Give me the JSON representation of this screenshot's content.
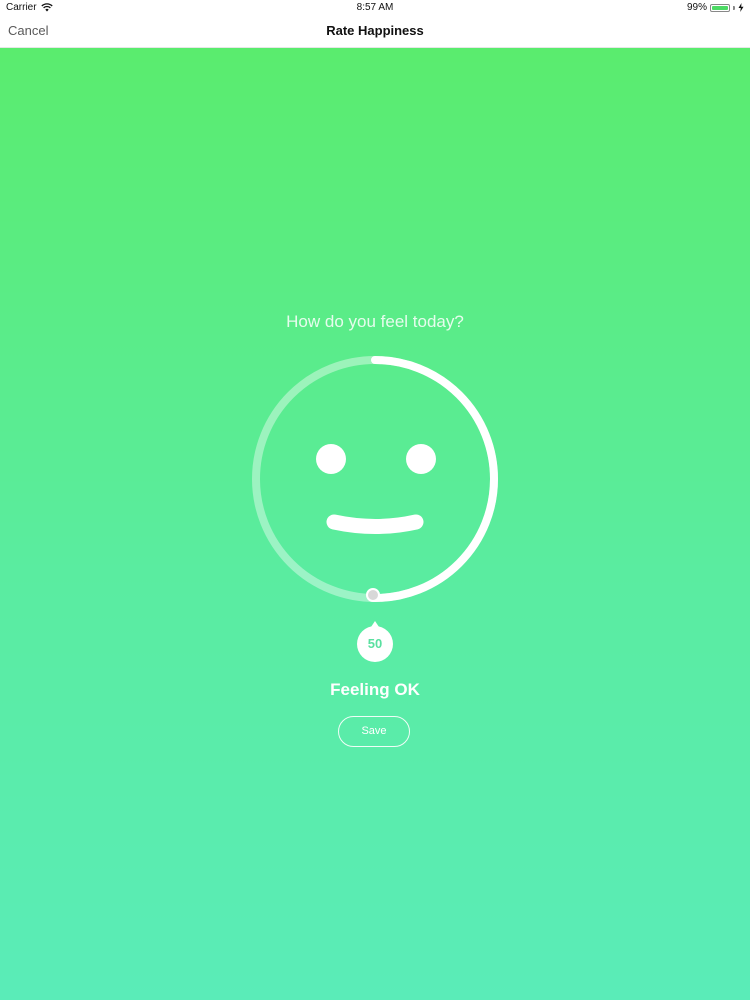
{
  "status_bar": {
    "carrier": "Carrier",
    "time": "8:57 AM",
    "battery": "99%",
    "battery_level": 0.99,
    "icons": [
      "wifi-icon",
      "battery-icon",
      "charging-icon"
    ]
  },
  "nav": {
    "cancel_label": "Cancel",
    "title": "Rate Happiness"
  },
  "rating": {
    "question": "How do you feel today?",
    "value": "50",
    "value_fraction": 0.5,
    "feeling": "Feeling OK",
    "save_label": "Save"
  },
  "colors": {
    "gradient_top": "#5aec6e",
    "gradient_bottom": "#5aecb8",
    "accent_text": "#5ae0a0",
    "white": "#ffffff"
  }
}
